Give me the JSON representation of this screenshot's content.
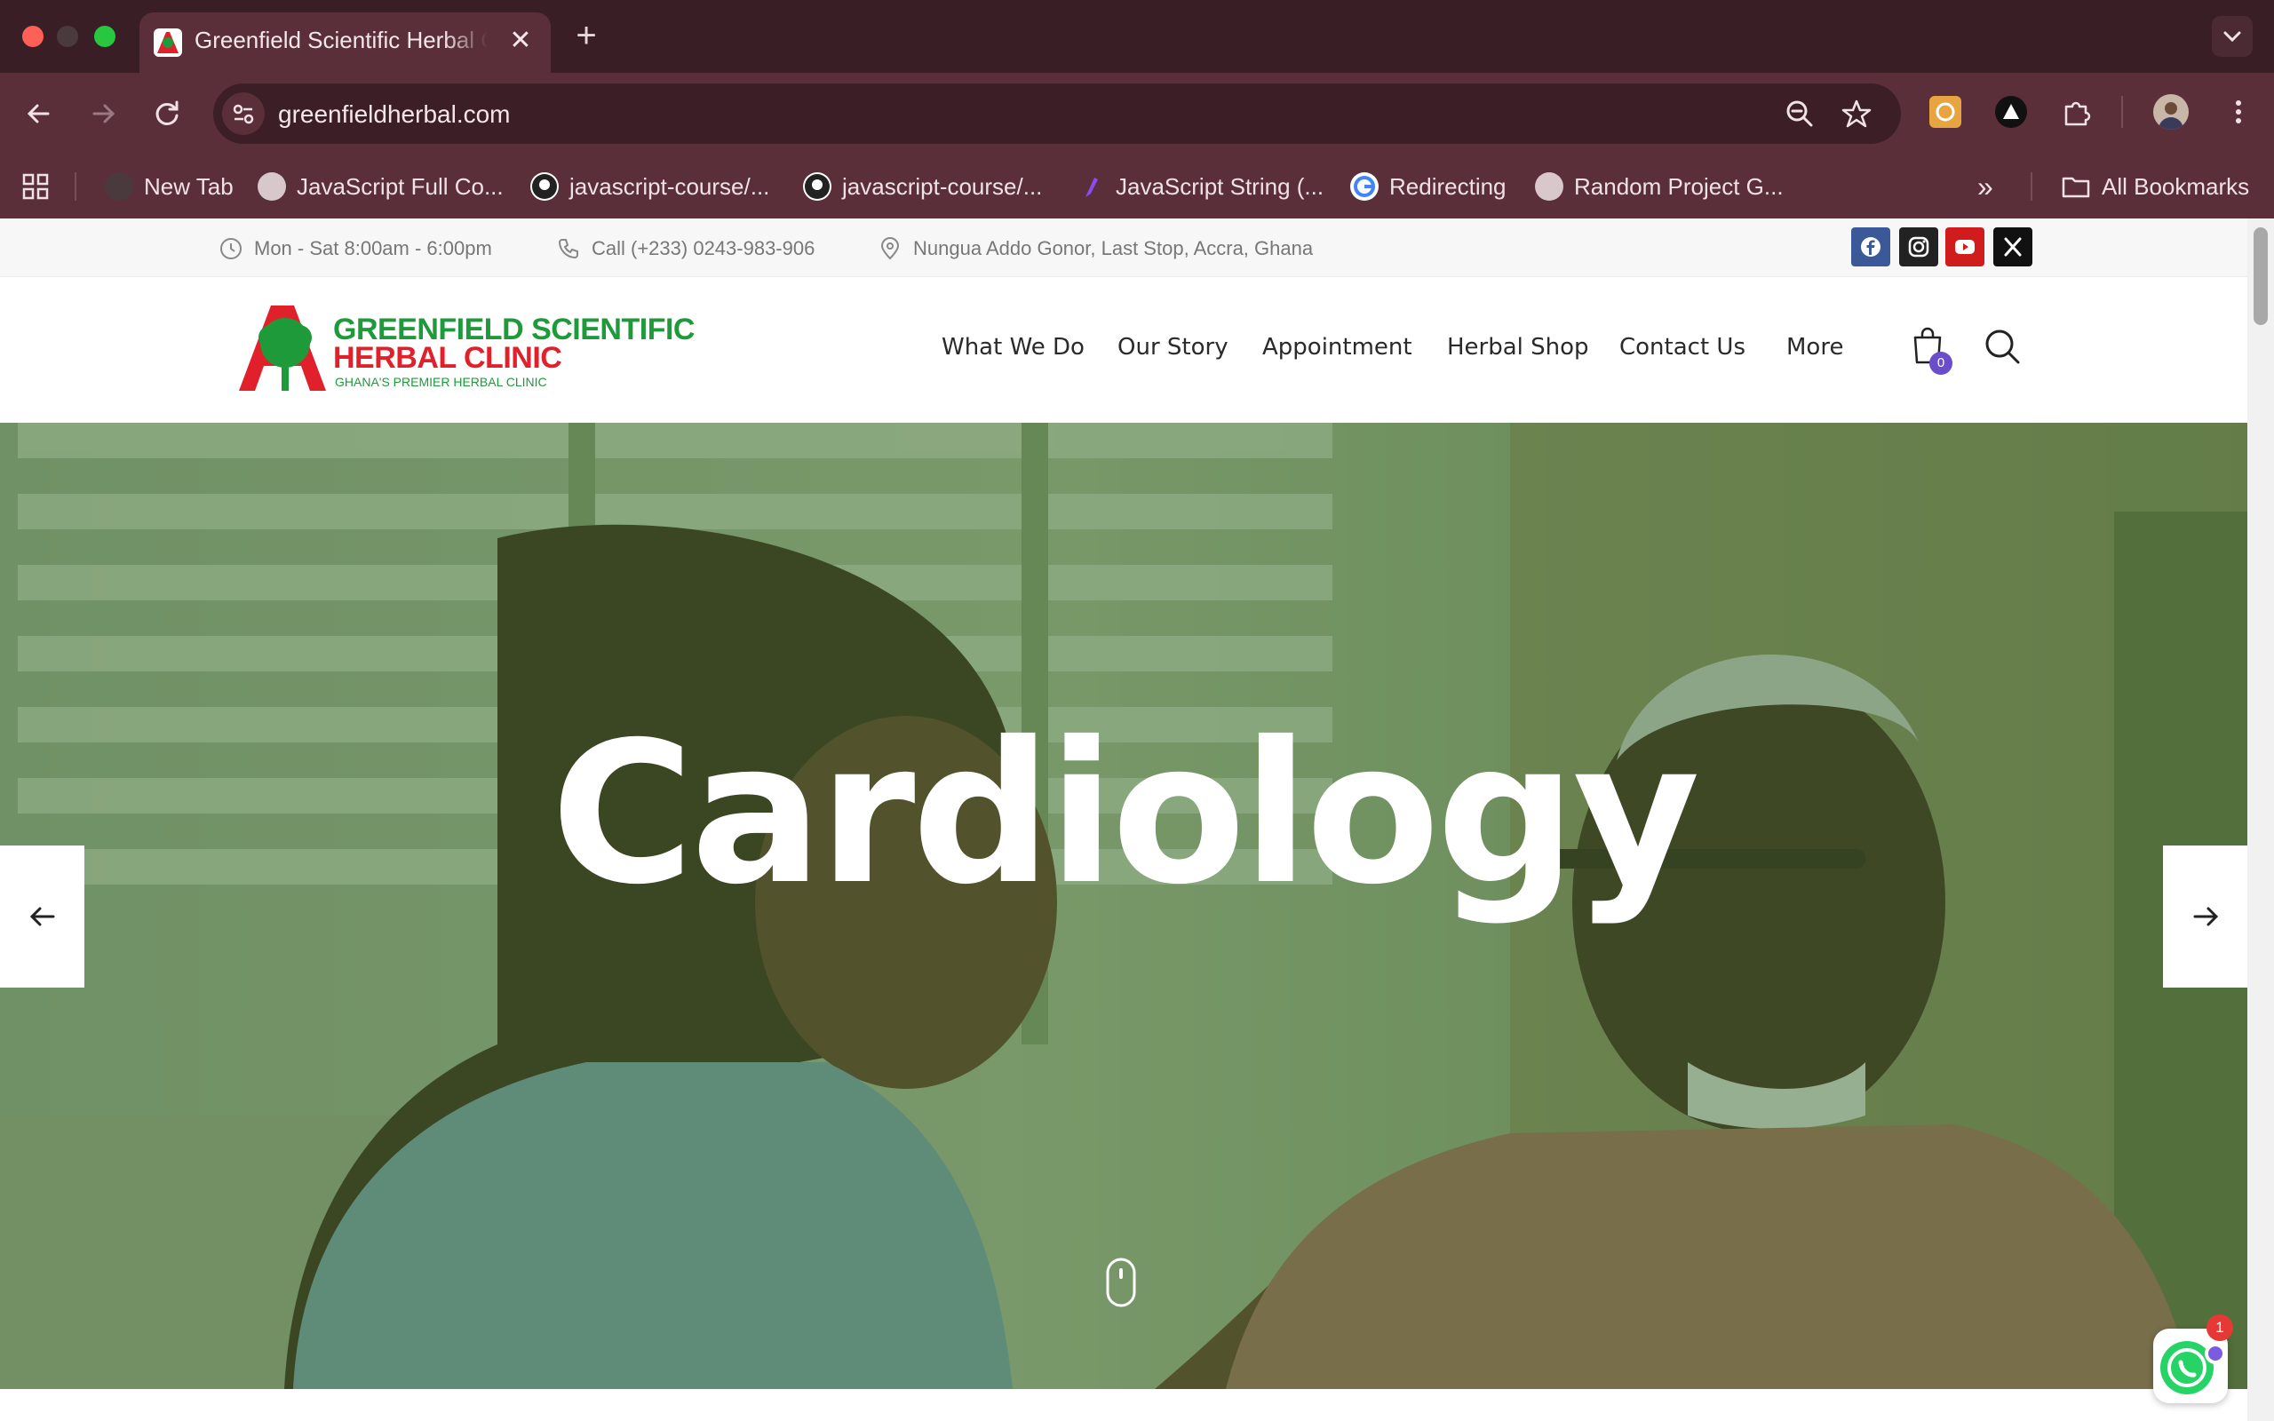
{
  "browser": {
    "tab_title": "Greenfield Scientific Herbal Clinic",
    "tab_close": "✕",
    "new_tab": "+",
    "url": "greenfieldherbal.com",
    "bookmarks": [
      {
        "label": "New Tab"
      },
      {
        "label": "JavaScript Full Co..."
      },
      {
        "label": "javascript-course/..."
      },
      {
        "label": "javascript-course/..."
      },
      {
        "label": "JavaScript String (..."
      },
      {
        "label": "Redirecting"
      },
      {
        "label": "Random Project G..."
      }
    ],
    "all_bookmarks": "All Bookmarks",
    "overflow": "»"
  },
  "topbar": {
    "hours": "Mon - Sat 8:00am - 6:00pm",
    "phone": "Call (+233) 0243-983-906",
    "address": "Nungua Addo Gonor, Last Stop, Accra, Ghana"
  },
  "logo": {
    "line1": "GREENFIELD SCIENTIFIC",
    "line2": "HERBAL CLINIC",
    "tagline": "GHANA'S PREMIER HERBAL CLINIC"
  },
  "nav": {
    "items": [
      "What We Do",
      "Our Story",
      "Appointment",
      "Herbal Shop",
      "Contact Us",
      "More"
    ],
    "cart_count": "0"
  },
  "hero": {
    "title": "Cardiology"
  },
  "whatsapp": {
    "badge": "1"
  },
  "colors": {
    "chrome": "#3a1e26",
    "toolbar": "#5a2f39",
    "brand_green": "#1f9a3a",
    "brand_red": "#e0202a",
    "hero_overlay": "#2e6b2a",
    "cart_badge": "#6a4ec9"
  }
}
